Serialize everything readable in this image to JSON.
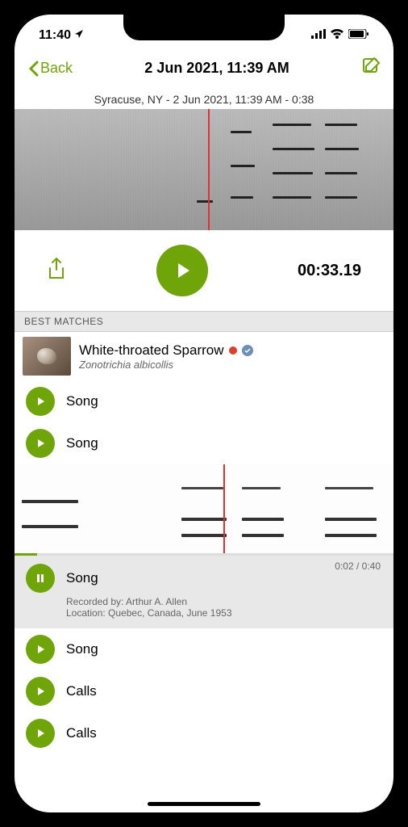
{
  "status": {
    "time": "11:40",
    "location_indicator": "➤"
  },
  "nav": {
    "back_label": "Back",
    "title": "2 Jun 2021, 11:39 AM"
  },
  "subtitle": "Syracuse, NY - 2 Jun 2021, 11:39 AM - 0:38",
  "timer": "00:33.19",
  "section_header": "BEST MATCHES",
  "species": {
    "common_name": "White-throated Sparrow",
    "scientific_name": "Zonotrichia albicollis"
  },
  "tracks": [
    {
      "label": "Song"
    },
    {
      "label": "Song"
    }
  ],
  "expanded": {
    "label": "Song",
    "current_time": "0:02",
    "total_time": "0:40",
    "recorded_by_label": "Recorded by:",
    "recorded_by": "Arthur A. Allen",
    "location_label": "Location:",
    "location": "Quebec, Canada, June 1953"
  },
  "tracks_after": [
    {
      "label": "Song"
    },
    {
      "label": "Calls"
    },
    {
      "label": "Calls"
    }
  ]
}
